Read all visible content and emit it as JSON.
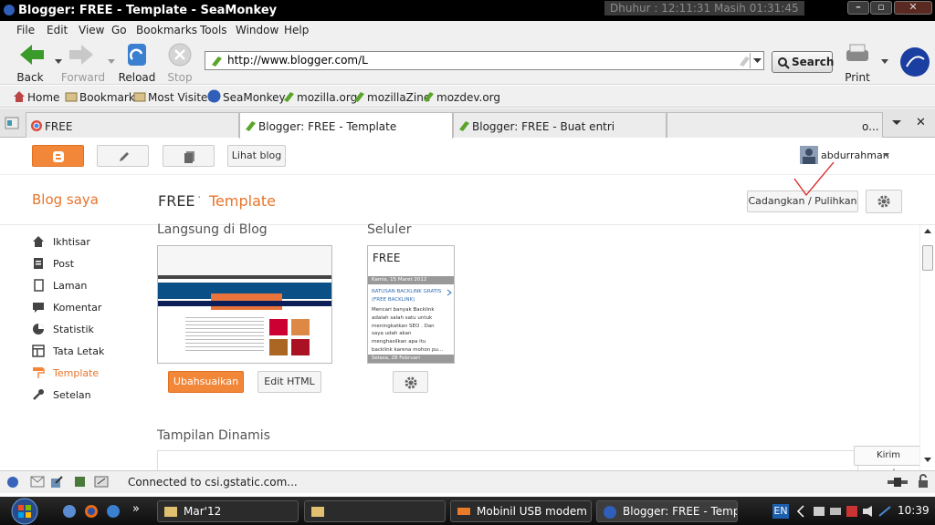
{
  "window": {
    "title": "Blogger: FREE - Template - SeaMonkey",
    "clock": "Dhuhur : 12:11:31  Masih 01:31:45"
  },
  "menu": [
    "File",
    "Edit",
    "View",
    "Go",
    "Bookmarks",
    "Tools",
    "Window",
    "Help"
  ],
  "toolbar": {
    "back": "Back",
    "forward": "Forward",
    "reload": "Reload",
    "stop": "Stop",
    "url": "http://www.blogger.com/L",
    "search": "Search",
    "print": "Print"
  },
  "bookmarks": [
    "Home",
    "Bookmarks",
    "Most Visited",
    "SeaMonkey",
    "mozilla.org",
    "mozillaZine",
    "mozdev.org"
  ],
  "tabs": [
    {
      "label": "FREE"
    },
    {
      "label": "Blogger: FREE - Template"
    },
    {
      "label": "Blogger: FREE - Buat entri"
    },
    {
      "label": "o..."
    }
  ],
  "blogger": {
    "view_blog": "Lihat blog",
    "user": "abdurrahman",
    "blog_saya": "Blog saya",
    "blog_name": "FREE",
    "separator": "·",
    "page_title": "Template",
    "backup_restore": "Cadangkan / Pulihkan",
    "nav": [
      "Ikhtisar",
      "Post",
      "Laman",
      "Komentar",
      "Statistik",
      "Tata Letak",
      "Template",
      "Setelan"
    ],
    "live_on_blog": "Langsung di Blog",
    "mobile": "Seluler",
    "customize": "Ubahsuaikan",
    "edit_html": "Edit HTML",
    "dynamic_views": "Tampilan Dinamis",
    "send_feedback": "Kirim masukan",
    "mobile_preview": {
      "blog_title": "FREE",
      "date1": "Kamis, 15 Maret 2012",
      "post_title": "RATUSAN BACKLINK GRATIS (FREE BACKLINK)",
      "excerpt": "Mencari banyak Backlink adalah salah satu untuk meningkatkan SEO . Dan saya udah akan menghasilkan apa itu backlink karena mohon pu...",
      "date2": "Selasa, 28 Februari"
    }
  },
  "status": {
    "text": "Connected to csi.gstatic.com..."
  },
  "taskbar": {
    "tasks": [
      "Mar'12",
      "",
      "Mobinil USB modem",
      "Blogger: FREE - Templ..."
    ],
    "lang": "EN",
    "time": "10:39"
  },
  "colors": {
    "accent": "#f2873a",
    "accent_text": "#e8742a"
  }
}
